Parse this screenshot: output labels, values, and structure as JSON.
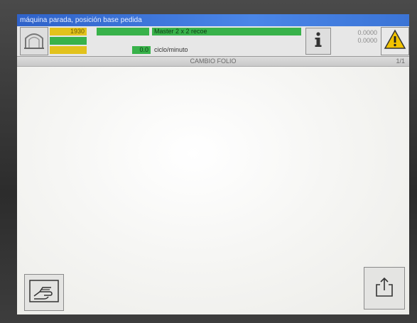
{
  "status_bar": {
    "text": "máquina parada, posición base pedida"
  },
  "header": {
    "counter_yellow": "1930",
    "machine_mode": "Master 2 x 2 recoe",
    "speed_value": "0.0",
    "speed_unit": "ciclo/minuto",
    "right_counter_line1": "0.0000",
    "right_counter_line2": "0.0000"
  },
  "title_bar": {
    "title": "CAMBIO FOLIO",
    "page": "1/1"
  },
  "icons": {
    "machine": "machine-icon",
    "info": "info-icon",
    "warning": "warning-icon",
    "hand": "hand-icon",
    "export": "export-icon"
  },
  "colors": {
    "status_bar": "#2f62c9",
    "yellow": "#e2c21c",
    "green": "#38b24a",
    "warning": "#f2c300"
  }
}
